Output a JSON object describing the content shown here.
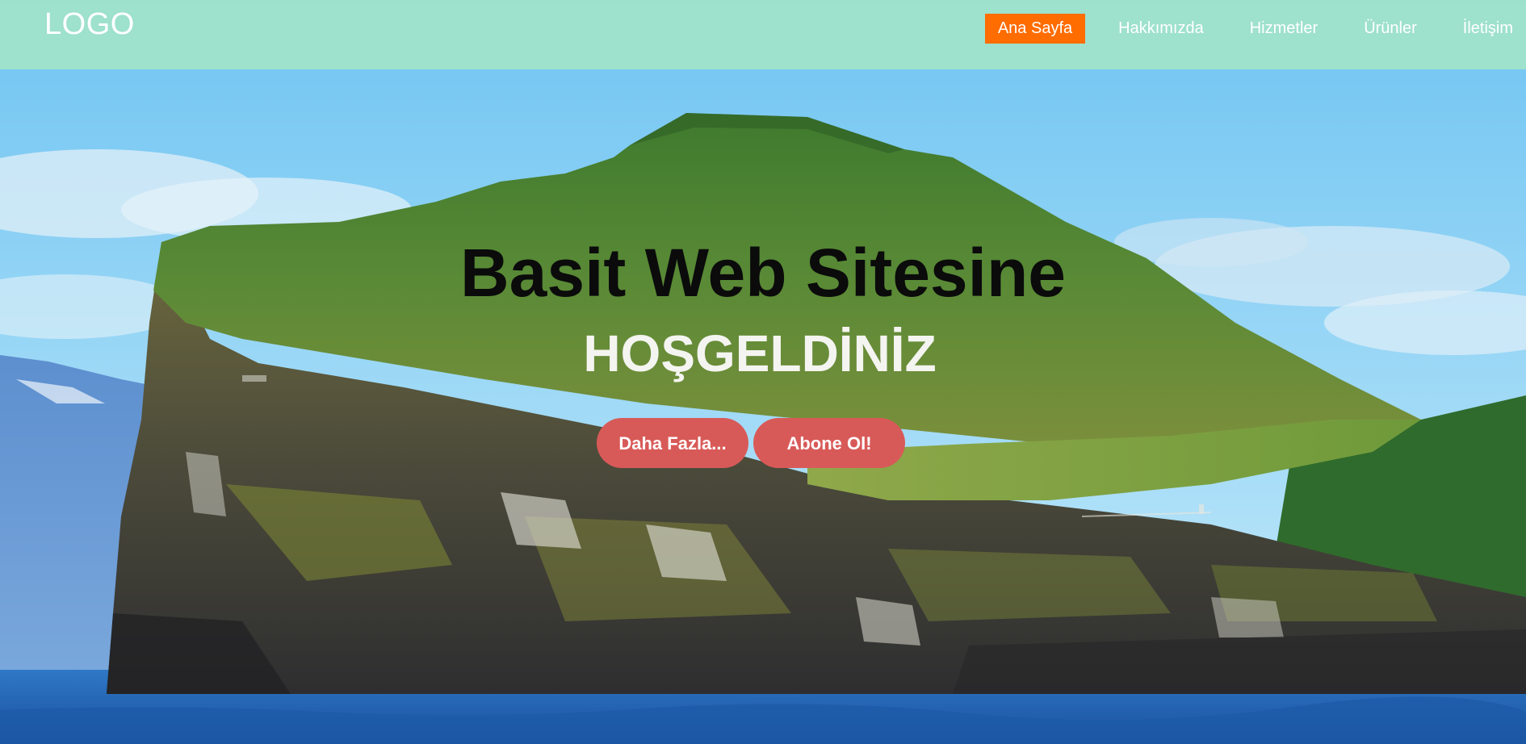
{
  "brand": {
    "logo_text": "LOGO"
  },
  "nav": {
    "items": [
      {
        "label": "Ana Sayfa",
        "active": true
      },
      {
        "label": "Hakkımızda",
        "active": false
      },
      {
        "label": "Hizmetler",
        "active": false
      },
      {
        "label": "Ürünler",
        "active": false
      },
      {
        "label": "İletişim",
        "active": false
      }
    ]
  },
  "hero": {
    "title": "Basit Web Sitesine",
    "subtitle": "HOŞGELDİNİZ",
    "buttons": [
      {
        "label": "Daha Fazla..."
      },
      {
        "label": "Abone Ol!"
      }
    ],
    "background_image": "island-cliff-photo"
  },
  "colors": {
    "navbar_bg": "#a0e2ca",
    "nav_active_bg": "#ff6c00",
    "cta_bg": "#d85a58"
  }
}
